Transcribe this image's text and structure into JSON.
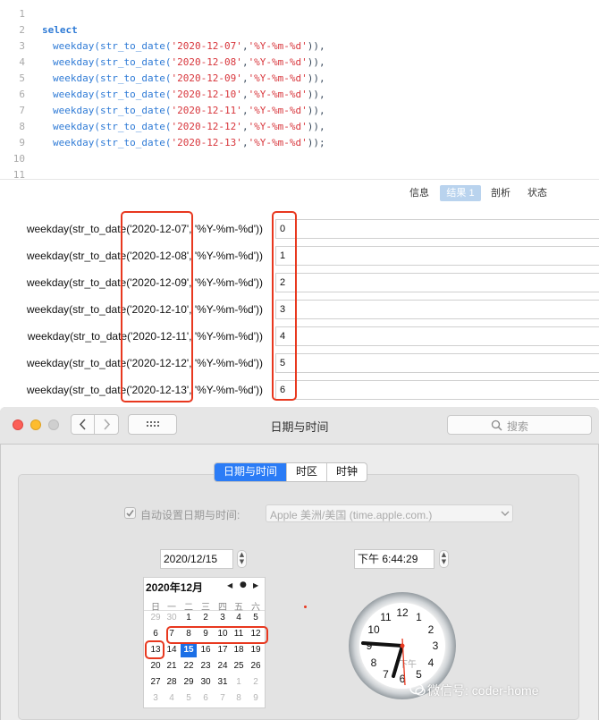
{
  "editor": {
    "line_numbers": [
      "1",
      "2",
      "3",
      "4",
      "5",
      "6",
      "7",
      "8",
      "9",
      "10",
      "11"
    ],
    "keyword_select": "select",
    "query_lines": [
      {
        "fn": "weekday(str_to_date(",
        "date": "'2020-12-07'",
        "sep": ",",
        "fmt": "'%Y-%m-%d'",
        "end": ")),"
      },
      {
        "fn": "weekday(str_to_date(",
        "date": "'2020-12-08'",
        "sep": ",",
        "fmt": "'%Y-%m-%d'",
        "end": ")),"
      },
      {
        "fn": "weekday(str_to_date(",
        "date": "'2020-12-09'",
        "sep": ",",
        "fmt": "'%Y-%m-%d'",
        "end": ")),"
      },
      {
        "fn": "weekday(str_to_date(",
        "date": "'2020-12-10'",
        "sep": ",",
        "fmt": "'%Y-%m-%d'",
        "end": ")),"
      },
      {
        "fn": "weekday(str_to_date(",
        "date": "'2020-12-11'",
        "sep": ",",
        "fmt": "'%Y-%m-%d'",
        "end": ")),"
      },
      {
        "fn": "weekday(str_to_date(",
        "date": "'2020-12-12'",
        "sep": ",",
        "fmt": "'%Y-%m-%d'",
        "end": ")),"
      },
      {
        "fn": "weekday(str_to_date(",
        "date": "'2020-12-13'",
        "sep": ",",
        "fmt": "'%Y-%m-%d'",
        "end": "));"
      }
    ]
  },
  "result_tabs": {
    "info": "信息",
    "result1": "结果 1",
    "profile": "剖析",
    "status": "状态"
  },
  "results": [
    {
      "label": "weekday(str_to_date('2020-12-07', '%Y-%m-%d'))",
      "value": "0"
    },
    {
      "label": "weekday(str_to_date('2020-12-08', '%Y-%m-%d'))",
      "value": "1"
    },
    {
      "label": "weekday(str_to_date('2020-12-09', '%Y-%m-%d'))",
      "value": "2"
    },
    {
      "label": "weekday(str_to_date('2020-12-10', '%Y-%m-%d'))",
      "value": "3"
    },
    {
      "label": "weekday(str_to_date('2020-12-11', '%Y-%m-%d'))",
      "value": "4"
    },
    {
      "label": "weekday(str_to_date('2020-12-12', '%Y-%m-%d'))",
      "value": "5"
    },
    {
      "label": "weekday(str_to_date('2020-12-13', '%Y-%m-%d'))",
      "value": "6"
    }
  ],
  "window": {
    "title": "日期与时间",
    "search_placeholder": "搜索",
    "tabs": [
      "日期与时间",
      "时区",
      "时钟"
    ],
    "auto_set_label": "自动设置日期与时间:",
    "auto_set_checked": true,
    "time_server": "Apple 美洲/美国 (time.apple.com.)",
    "date_value": "2020/12/15",
    "time_value": "下午  6:44:29"
  },
  "calendar": {
    "month_label": "2020年12月",
    "nav": [
      "◀",
      "●",
      "▶"
    ],
    "weekdays": [
      "日",
      "一",
      "二",
      "三",
      "四",
      "五",
      "六"
    ],
    "weeks": [
      [
        "29",
        "30",
        "1",
        "2",
        "3",
        "4",
        "5"
      ],
      [
        "6",
        "7",
        "8",
        "9",
        "10",
        "11",
        "12"
      ],
      [
        "13",
        "14",
        "15",
        "16",
        "17",
        "18",
        "19"
      ],
      [
        "20",
        "21",
        "22",
        "23",
        "24",
        "25",
        "26"
      ],
      [
        "27",
        "28",
        "29",
        "30",
        "31",
        "1",
        "2"
      ],
      [
        "3",
        "4",
        "5",
        "6",
        "7",
        "8",
        "9"
      ]
    ],
    "selected_day": "15"
  },
  "clock": {
    "numbers": [
      "12",
      "1",
      "2",
      "3",
      "4",
      "5",
      "6",
      "7",
      "8",
      "9",
      "10",
      "11"
    ],
    "am_pm": "下午",
    "time": "6:44:29"
  },
  "watermark": "微信号: coder-home",
  "colors": {
    "highlight_red": "#e8381f",
    "accent_blue": "#2b7cf6",
    "keyword_blue": "#2f7bd6",
    "string_red": "#d8363c"
  }
}
